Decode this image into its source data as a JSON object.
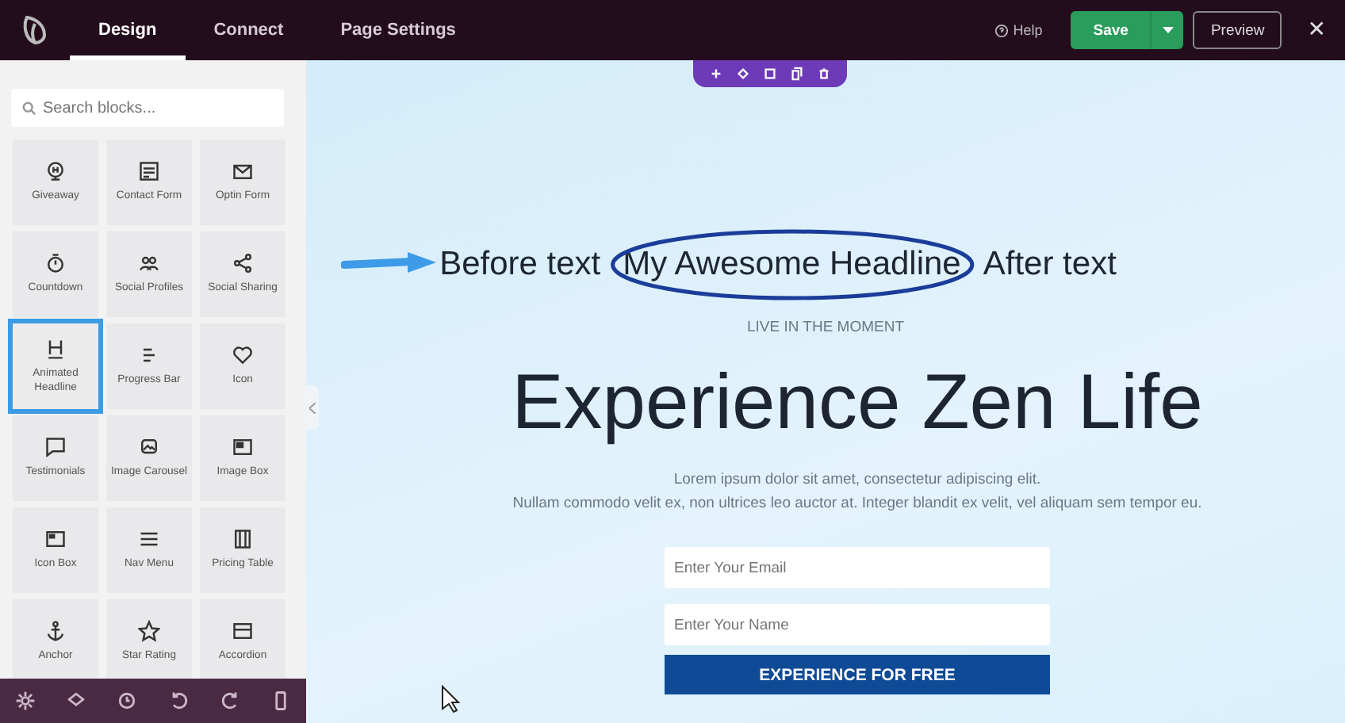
{
  "topbar": {
    "tabs": [
      {
        "label": "Design",
        "selected": true
      },
      {
        "label": "Connect",
        "selected": false
      },
      {
        "label": "Page Settings",
        "selected": false
      }
    ],
    "help": "Help",
    "save": "Save",
    "preview": "Preview",
    "close": "✕"
  },
  "sidebar": {
    "search": {
      "placeholder": "Search blocks..."
    },
    "blocks": [
      {
        "label": "Giveaway",
        "selected": false
      },
      {
        "label": "Contact Form",
        "selected": false
      },
      {
        "label": "Optin Form",
        "selected": false
      },
      {
        "label": "Countdown",
        "selected": false
      },
      {
        "label": "Social Profiles",
        "selected": false
      },
      {
        "label": "Social Sharing",
        "selected": false
      },
      {
        "label": "Animated Headline",
        "selected": true
      },
      {
        "label": "Progress Bar",
        "selected": false
      },
      {
        "label": "Icon",
        "selected": false
      },
      {
        "label": "Testimonials",
        "selected": false
      },
      {
        "label": "Image Carousel",
        "selected": false
      },
      {
        "label": "Image Box",
        "selected": false
      },
      {
        "label": "Icon Box",
        "selected": false
      },
      {
        "label": "Nav Menu",
        "selected": false
      },
      {
        "label": "Pricing Table",
        "selected": false
      },
      {
        "label": "Anchor",
        "selected": false
      },
      {
        "label": "Star Rating",
        "selected": false
      },
      {
        "label": "Accordion",
        "selected": false
      }
    ]
  },
  "canvas": {
    "headline": {
      "before": "Before text",
      "highlight": "My Awesome Headline",
      "after": "After text"
    },
    "eyebrow": "LIVE IN THE MOMENT",
    "title": "Experience Zen Life",
    "body": [
      "Lorem ipsum dolor sit amet, consectetur adipiscing elit.",
      "Nullam commodo velit ex, non ultrices leo auctor at. Integer blandit ex velit, vel aliquam sem tempor eu."
    ],
    "fields": [
      {
        "placeholder": "Enter Your Email"
      },
      {
        "placeholder": "Enter Your Name"
      }
    ],
    "cta": "EXPERIENCE FOR FREE"
  }
}
